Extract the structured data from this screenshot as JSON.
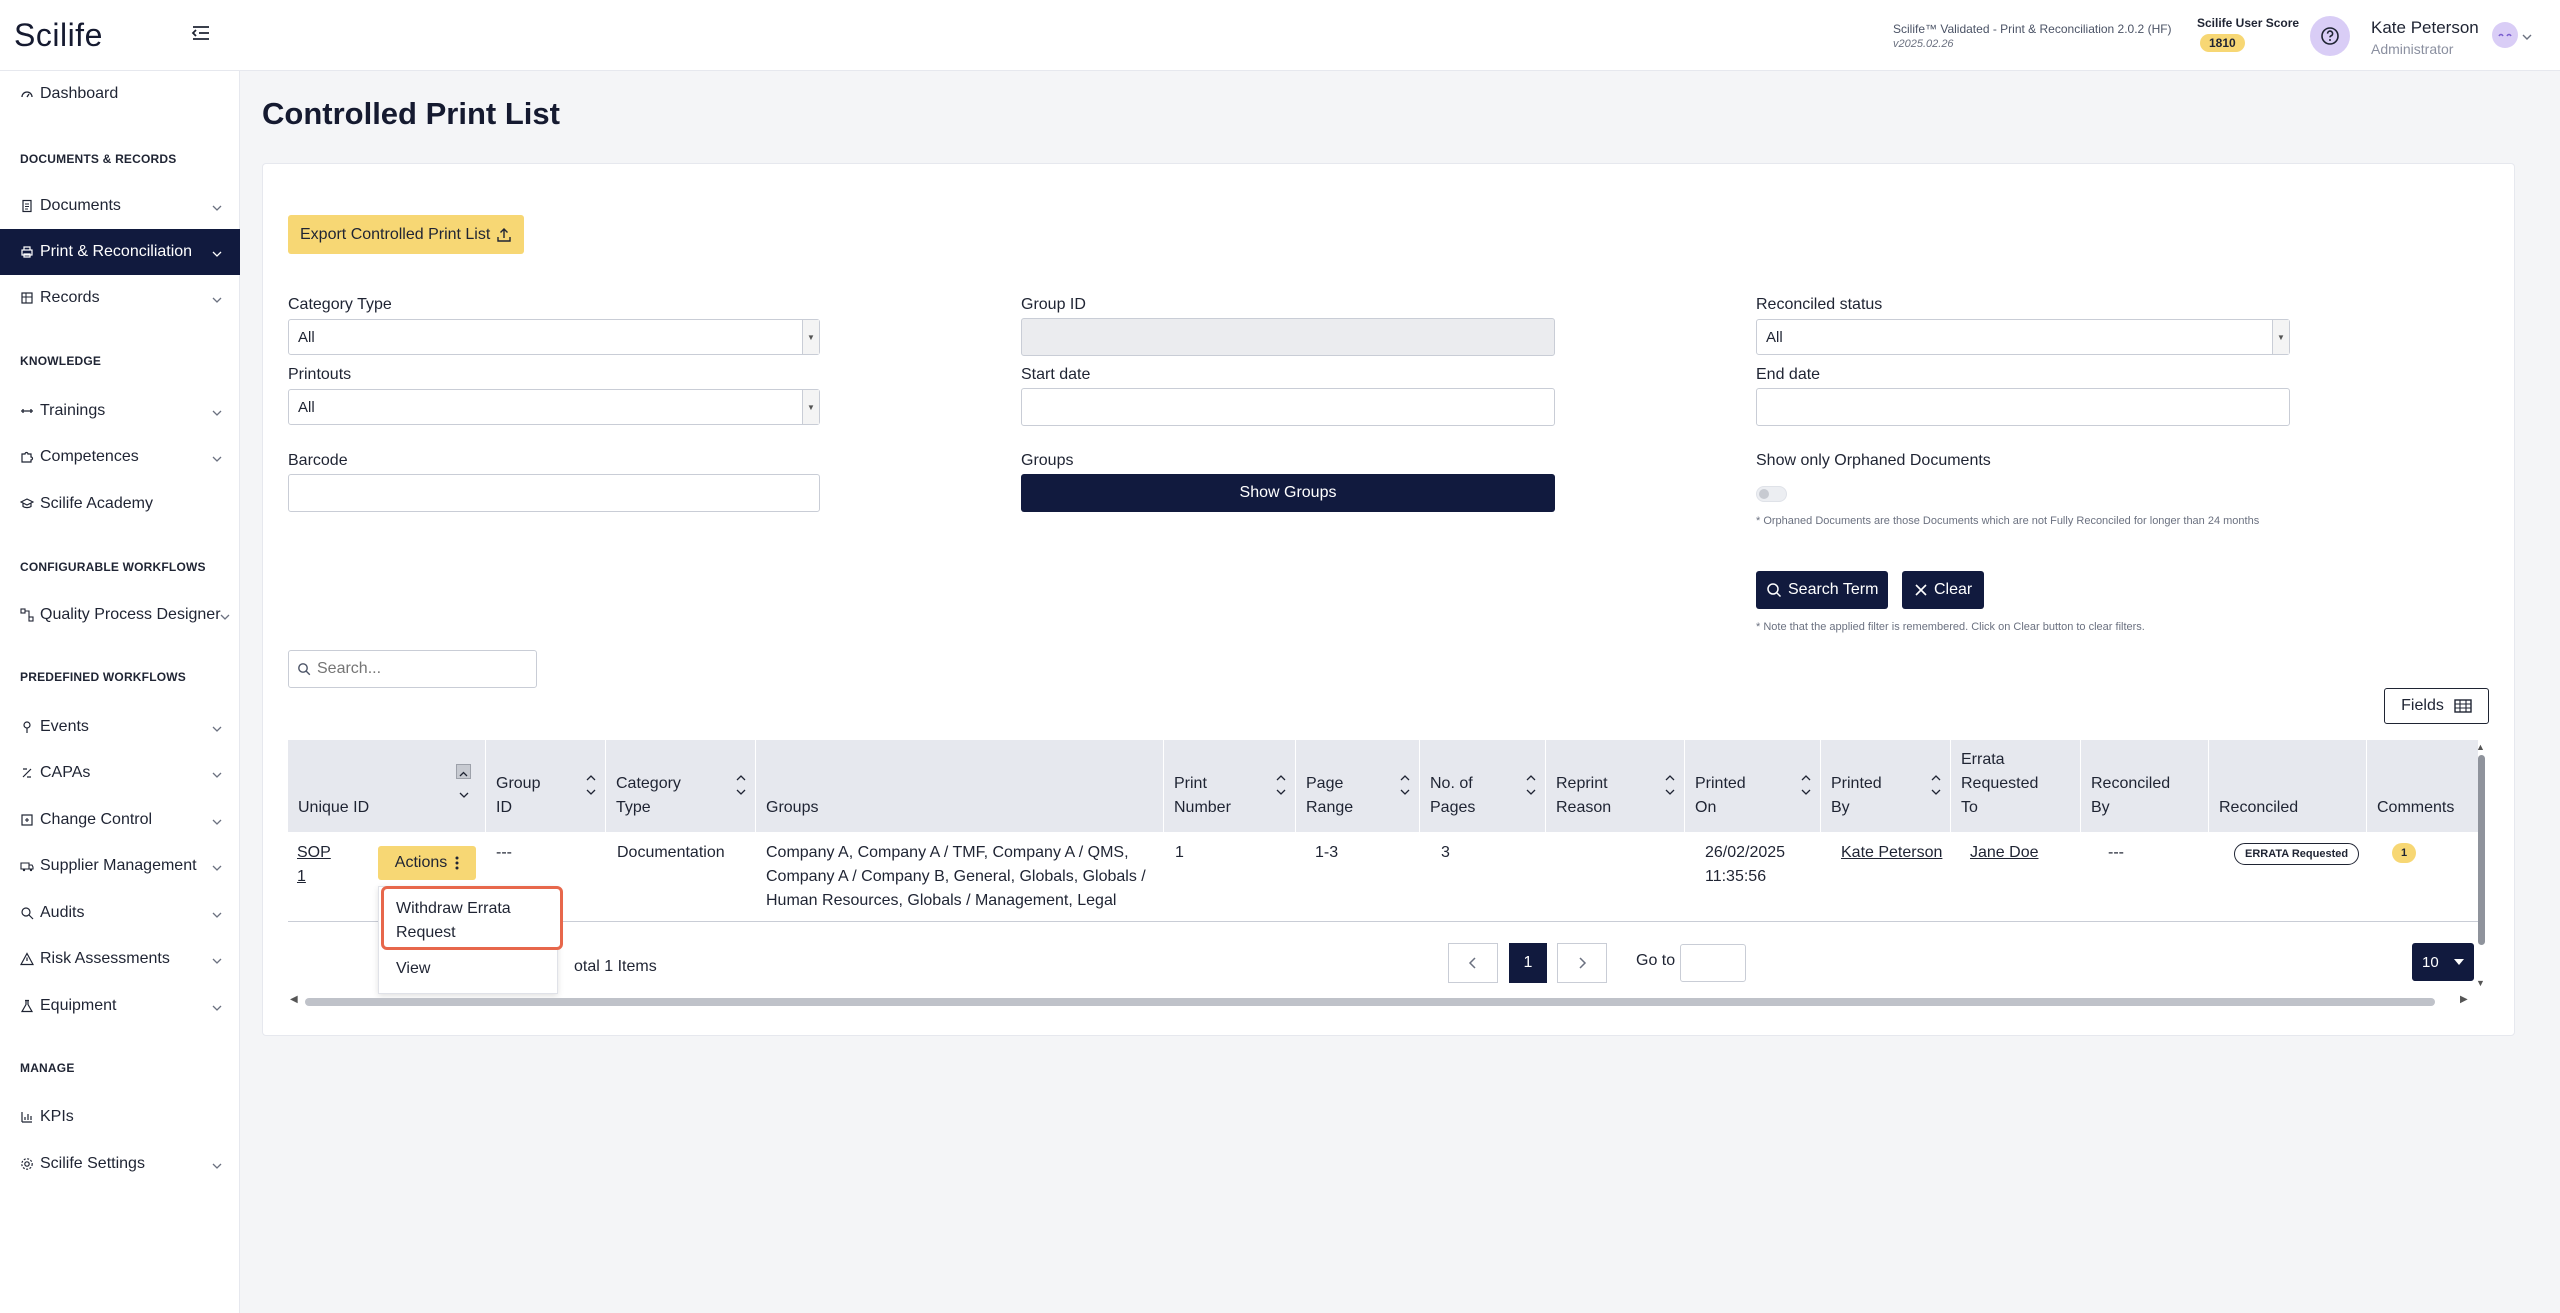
{
  "header": {
    "logo": "Scilife",
    "version_line": "Scilife™ Validated - Print & Reconciliation 2.0.2 (HF)",
    "version_date": "v2025.02.26",
    "score_label": "Scilife User Score",
    "score_value": "1810",
    "user_name": "Kate Peterson",
    "user_role": "Administrator"
  },
  "sidebar": {
    "dashboard": "Dashboard",
    "sec_docs": "DOCUMENTS & RECORDS",
    "documents": "Documents",
    "print_rec": "Print & Reconciliation",
    "records": "Records",
    "sec_knowledge": "KNOWLEDGE",
    "trainings": "Trainings",
    "competences": "Competences",
    "academy": "Scilife Academy",
    "sec_config": "CONFIGURABLE WORKFLOWS",
    "qpd": "Quality Process Designer",
    "sec_predef": "PREDEFINED WORKFLOWS",
    "events": "Events",
    "capas": "CAPAs",
    "change_control": "Change Control",
    "supplier": "Supplier Management",
    "audits": "Audits",
    "risk": "Risk Assessments",
    "equipment": "Equipment",
    "sec_manage": "MANAGE",
    "kpis": "KPIs",
    "settings": "Scilife Settings"
  },
  "page": {
    "title": "Controlled Print List",
    "export_label": "Export Controlled Print List"
  },
  "filters": {
    "category_type_label": "Category Type",
    "category_type_value": "All",
    "printouts_label": "Printouts",
    "printouts_value": "All",
    "barcode_label": "Barcode",
    "group_id_label": "Group ID",
    "start_date_label": "Start date",
    "groups_label": "Groups",
    "show_groups_label": "Show Groups",
    "reconciled_label": "Reconciled status",
    "reconciled_value": "All",
    "end_date_label": "End date",
    "orphaned_label": "Show only Orphaned Documents",
    "orphaned_note": "* Orphaned Documents are those Documents which are not Fully Reconciled for longer than 24 months",
    "search_term_label": "Search Term",
    "clear_label": "Clear",
    "filter_note": "* Note that the applied filter is remembered. Click on Clear button to clear filters."
  },
  "table": {
    "search_placeholder": "Search...",
    "fields_label": "Fields",
    "columns": {
      "unique_id": "Unique ID",
      "group_id_1": "Group",
      "group_id_2": "ID",
      "category_1": "Category",
      "category_2": "Type",
      "groups": "Groups",
      "print_number_1": "Print",
      "print_number_2": "Number",
      "page_range_1": "Page",
      "page_range_2": "Range",
      "no_pages_1": "No. of",
      "no_pages_2": "Pages",
      "reprint_1": "Reprint",
      "reprint_2": "Reason",
      "printed_on_1": "Printed",
      "printed_on_2": "On",
      "printed_by_1": "Printed",
      "printed_by_2": "By",
      "errata_1": "Errata",
      "errata_2": "Requested",
      "errata_3": "To",
      "reconciled_by_1": "Reconciled",
      "reconciled_by_2": "By",
      "reconciled": "Reconciled",
      "comments": "Comments"
    },
    "row": {
      "unique_id_1": "SOP",
      "unique_id_2": "1",
      "actions_label": "Actions",
      "group_id": "---",
      "category_type": "Documentation",
      "groups_1": "Company A, Company A / TMF, Company A / QMS,",
      "groups_2": "Company A / Company B, General, Globals, Globals /",
      "groups_3": "Human Resources, Globals / Management, Legal",
      "print_number": "1",
      "page_range": "1-3",
      "no_pages": "3",
      "printed_on_1": "26/02/2025",
      "printed_on_2": "11:35:56",
      "printed_by": "Kate Peterson",
      "errata_to": "Jane Doe",
      "reconciled_by": "---",
      "reconciled_status": "ERRATA Requested",
      "comments_count": "1"
    },
    "menu": {
      "withdraw_1": "Withdraw Errata",
      "withdraw_2": "Request",
      "view": "View"
    },
    "footer": {
      "total": "otal 1 Items",
      "current_page": "1",
      "goto_label": "Go to",
      "page_size": "10"
    }
  },
  "colors": {
    "navy": "#111a3e",
    "accent_yellow": "#f7d774",
    "highlight": "#e7674b"
  }
}
